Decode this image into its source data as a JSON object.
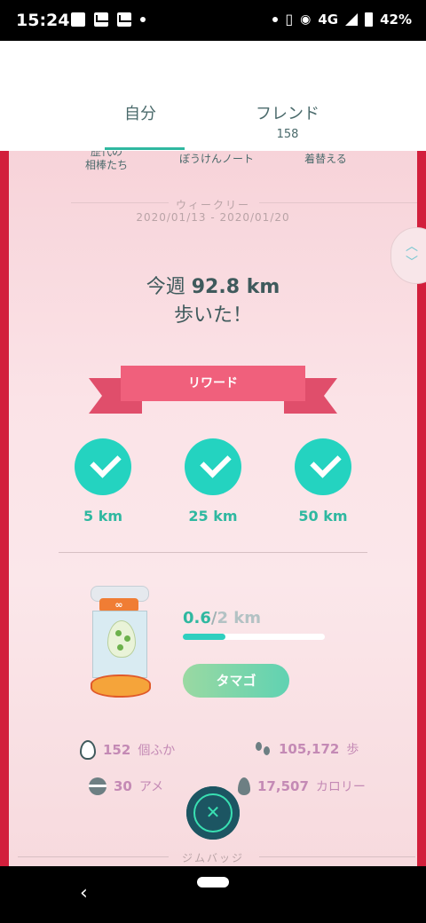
{
  "status_bar": {
    "time": "15:24",
    "network": "4G",
    "battery": "42%"
  },
  "header": {
    "tabs": [
      {
        "label": "自分"
      },
      {
        "label": "フレンド",
        "count": "158"
      }
    ]
  },
  "quick_links": [
    "歴代の\n相棒たち",
    "ぼうけんノート",
    "着替える"
  ],
  "weekly": {
    "label": "ウィークリー",
    "dates": "2020/01/13 - 2020/01/20",
    "headline_prefix": "今週",
    "distance": "92.8 km",
    "headline_suffix": "歩いた！"
  },
  "reward": {
    "label": "リワード",
    "milestones": [
      {
        "km": "5 km"
      },
      {
        "km": "25 km"
      },
      {
        "km": "50 km"
      }
    ]
  },
  "egg": {
    "incubator_label": "∞",
    "walked": "0.6",
    "separator": "/",
    "goal": "2 km",
    "progress_fraction": 0.3,
    "button_label": "タマゴ"
  },
  "stats": {
    "hatched": {
      "value": "152",
      "unit": "個ふか"
    },
    "steps": {
      "value": "105,172",
      "unit": "歩"
    },
    "candy": {
      "value": "30",
      "unit": "アメ"
    },
    "calories": {
      "value": "17,507",
      "unit": "カロリー"
    }
  },
  "close_symbol": "✕",
  "gym_badges_label": "ジムバッジ",
  "nav": {
    "back": "‹"
  },
  "colors": {
    "accent": "#24d3c0",
    "ribbon": "#f0607c",
    "panel_border": "#d21f3c",
    "stat_value": "#c48ab5"
  }
}
